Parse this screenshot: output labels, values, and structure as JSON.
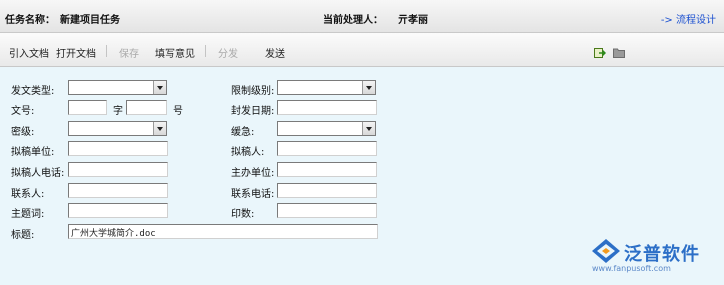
{
  "header": {
    "task_name_label": "任务名称：",
    "task_name_value": "新建项目任务",
    "handler_label": "当前处理人：",
    "handler_value": "亓孝丽",
    "flow_link": "-> 流程设计"
  },
  "toolbar": {
    "import_doc": "引入文档",
    "open_doc": "打开文档",
    "save": "保存",
    "fill_opinion": "填写意见",
    "distribute": "分发",
    "send": "发送",
    "icons": [
      "export-icon",
      "folder-icon"
    ]
  },
  "form": {
    "doc_type_label": "发文类型:",
    "doc_type_value": "",
    "secret_level_label": "限制级别:",
    "secret_level_value": "",
    "doc_no_label": "文号:",
    "doc_no_prefix": "",
    "zi_label": "字",
    "doc_no_number": "",
    "hao_label": "号",
    "seal_date_label": "封发日期:",
    "seal_date_value": "",
    "classification_label": "密级:",
    "classification_value": "",
    "urgency_label": "缓急:",
    "urgency_value": "",
    "draft_unit_label": "拟稿单位:",
    "draft_unit_value": "",
    "drafter_label": "拟稿人:",
    "drafter_value": "",
    "drafter_phone_label": "拟稿人电话:",
    "drafter_phone_value": "",
    "host_unit_label": "主办单位:",
    "host_unit_value": "",
    "contact_label": "联系人:",
    "contact_value": "",
    "contact_phone_label": "联系电话:",
    "contact_phone_value": "",
    "keywords_label": "主题词:",
    "keywords_value": "",
    "copies_label": "印数:",
    "copies_value": "",
    "title_label": "标题:",
    "title_value": "广州大学城简介.doc"
  },
  "logo": {
    "brand": "泛普软件",
    "url": "www.fanpusoft.com"
  }
}
